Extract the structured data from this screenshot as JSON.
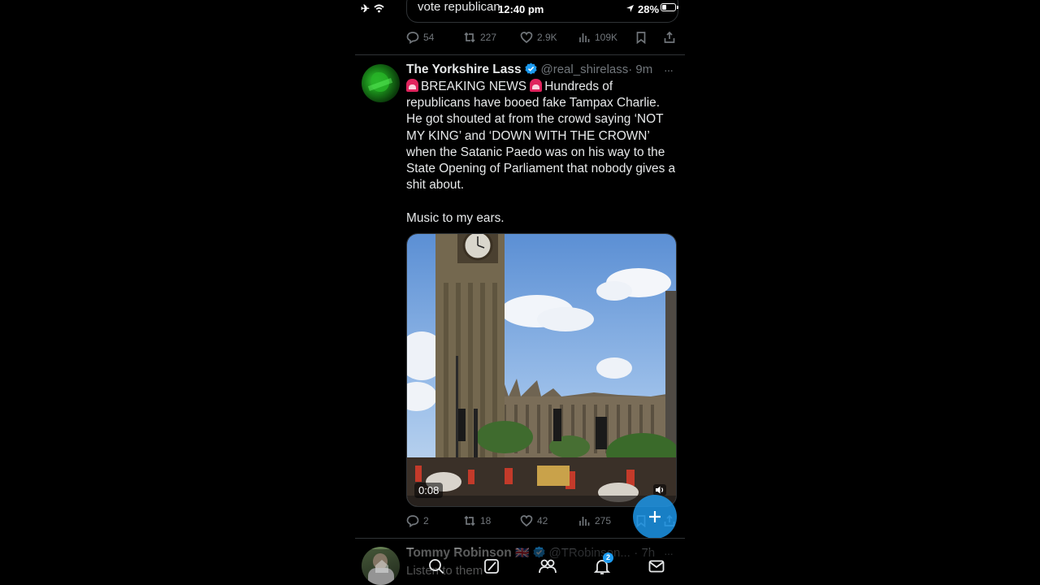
{
  "status_bar": {
    "time": "12:40 pm",
    "battery": "28%"
  },
  "prev_tweet": {
    "text_fragment": "vote republican",
    "replies": "54",
    "reposts": "227",
    "likes": "2.9K",
    "views": "109K"
  },
  "tweet": {
    "author_name": "The Yorkshire Lass",
    "handle": "@real_shirelass",
    "time": "· 9m",
    "more": "···",
    "text_breaking": "BREAKING NEWS",
    "text_body": "Hundreds of republicans have booed fake Tampax Charlie. He got shouted at from the crowd saying ‘NOT MY KING’ and ‘DOWN WITH THE CROWN’ when the Satanic Paedo was on his way to the State Opening of Parliament that nobody gives a shit about.",
    "text_footer": "Music to my ears.",
    "video_time": "0:08",
    "replies": "2",
    "reposts": "18",
    "likes": "42",
    "views": "275"
  },
  "next_tweet": {
    "author_name": "Tommy Robinson",
    "flag": "🇬🇧",
    "handle": "@TRobinson...",
    "time": "· 7h",
    "text": "Listen to them"
  },
  "bottom_nav": {
    "notification_count": "2"
  },
  "colors": {
    "accent": "#1d9bf0",
    "background": "#000000",
    "muted": "#71767b"
  }
}
